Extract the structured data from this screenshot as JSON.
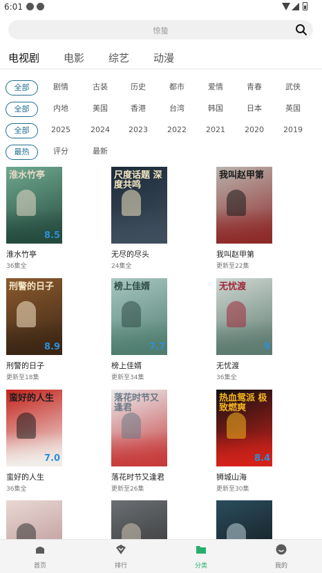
{
  "status": {
    "time": "6:01"
  },
  "search": {
    "placeholder": "惊蛰"
  },
  "tabs": [
    {
      "label": "电视剧",
      "active": true
    },
    {
      "label": "电影",
      "active": false
    },
    {
      "label": "综艺",
      "active": false
    },
    {
      "label": "动漫",
      "active": false
    }
  ],
  "filters": {
    "genre": [
      "全部",
      "剧情",
      "古装",
      "历史",
      "都市",
      "爱情",
      "青春",
      "武侠"
    ],
    "region": [
      "全部",
      "内地",
      "美国",
      "香港",
      "台湾",
      "韩国",
      "日本",
      "英国"
    ],
    "year": [
      "全部",
      "2025",
      "2024",
      "2023",
      "2022",
      "2021",
      "2020",
      "2019"
    ],
    "sort": [
      "最热",
      "评分",
      "最新"
    ]
  },
  "items": [
    {
      "title": "淮水竹亭",
      "sub": "36集全",
      "poster_text": "淮水竹亭",
      "rating": "8.5",
      "colors": [
        "#6fa88f",
        "#244a3e",
        "#e8d9c8"
      ]
    },
    {
      "title": "无尽的尽头",
      "sub": "24集全",
      "poster_text": "尺度话题 深度共鸣",
      "rating": "",
      "colors": [
        "#1d2b3a",
        "#3f4e5c",
        "#f2e6c2"
      ]
    },
    {
      "title": "我叫赵甲第",
      "sub": "更新至22集",
      "poster_text": "我叫赵甲第",
      "rating": "",
      "colors": [
        "#b9b3ad",
        "#8e2a2a",
        "#1a1a1a"
      ]
    },
    {
      "title": "刑警的日子",
      "sub": "更新至18集",
      "poster_text": "刑警的日子",
      "rating": "8.9",
      "colors": [
        "#8a5a2e",
        "#3b2614",
        "#f5e6c8"
      ]
    },
    {
      "title": "榜上佳婿",
      "sub": "更新至34集",
      "poster_text": "榜上佳婿",
      "rating": "7.7",
      "colors": [
        "#a8c7c1",
        "#4f7d6f",
        "#2f4d45"
      ]
    },
    {
      "title": "无忧渡",
      "sub": "36集全",
      "poster_text": "无忧渡",
      "rating": "9",
      "colors": [
        "#cfd7d2",
        "#5c7a6f",
        "#a02a3a"
      ]
    },
    {
      "title": "蛮好的人生",
      "sub": "36集全",
      "poster_text": "蛮好的人生",
      "rating": "7.0",
      "colors": [
        "#c4221c",
        "#f1eeea",
        "#1c1c1c"
      ]
    },
    {
      "title": "落花时节又逢君",
      "sub": "更新至26集",
      "poster_text": "落花时节又逢君",
      "rating": "",
      "colors": [
        "#e9ecef",
        "#c73a3a",
        "#6a7a86"
      ]
    },
    {
      "title": "狮城山海",
      "sub": "更新至30集",
      "poster_text": "热血鸳派 极致燃爽",
      "rating": "8.4",
      "colors": [
        "#111111",
        "#d4221a",
        "#f2b71e"
      ]
    },
    {
      "title": "",
      "sub": "",
      "poster_text": "",
      "rating": "",
      "colors": [
        "#e8d8d3",
        "#b2878a",
        "#333333"
      ]
    },
    {
      "title": "",
      "sub": "",
      "poster_text": "",
      "rating": "",
      "colors": [
        "#6b6f73",
        "#2a2a2a",
        "#cfc6b4"
      ]
    },
    {
      "title": "",
      "sub": "",
      "poster_text": "",
      "rating": "",
      "colors": [
        "#2a4d5e",
        "#101010",
        "#bcd2d8"
      ]
    }
  ],
  "bottom_nav": [
    {
      "label": "首页",
      "icon": "home-icon",
      "active": false
    },
    {
      "label": "排行",
      "icon": "ranking-icon",
      "active": false
    },
    {
      "label": "分类",
      "icon": "folder-icon",
      "active": true
    },
    {
      "label": "我的",
      "icon": "profile-icon",
      "active": false
    }
  ],
  "colors": {
    "accent": "#1e6c8e",
    "nav_active": "#27ad6f"
  }
}
